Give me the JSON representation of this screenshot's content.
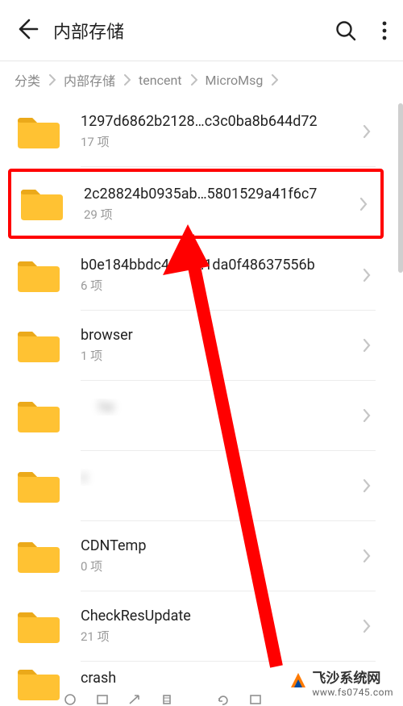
{
  "header": {
    "title": "内部存储"
  },
  "breadcrumb": {
    "items": [
      "分类",
      "内部存储",
      "tencent",
      "MicroMsg"
    ]
  },
  "folders": [
    {
      "name": "1297d6862b2128…c3c0ba8b644d72",
      "count": "17 项",
      "highlighted": false
    },
    {
      "name": "2c28824b0935ab…5801529a41f6c7",
      "count": "29 项",
      "highlighted": true
    },
    {
      "name": "b0e184bbdc4a  ff…1da0f48637556b",
      "count": "6 项",
      "highlighted": false
    },
    {
      "name": "browser",
      "count": "1 项",
      "highlighted": false
    },
    {
      "name": "     he",
      "count": "    ",
      "highlighted": false,
      "blurred": true
    },
    {
      "name": "c      ",
      "count": "    ",
      "highlighted": false,
      "blurred": true
    },
    {
      "name": "CDNTemp",
      "count": "0 项",
      "highlighted": false
    },
    {
      "name": "CheckResUpdate",
      "count": "21 项",
      "highlighted": false
    },
    {
      "name": "crash",
      "count": "",
      "highlighted": false,
      "partial": true
    }
  ],
  "watermark": {
    "brand": "飞沙系统网",
    "url": "www.fs0745.com"
  },
  "colors": {
    "highlight": "#ff0000",
    "folder": "#ffc233",
    "folder_tab": "#eba91a"
  }
}
